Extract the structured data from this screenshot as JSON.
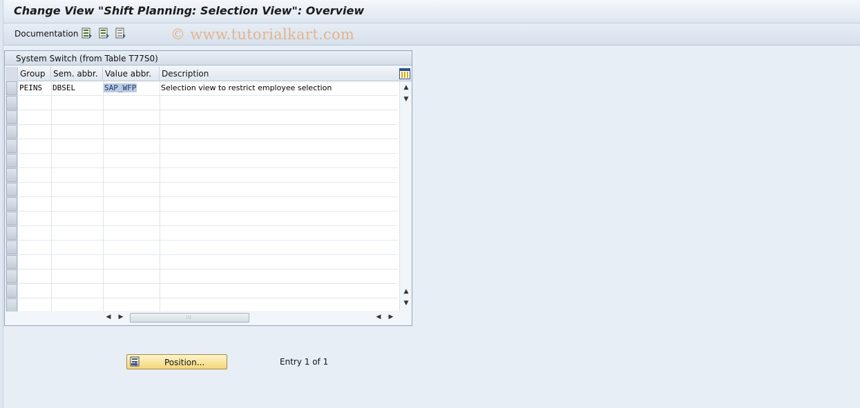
{
  "window": {
    "title": "Change View \"Shift Planning: Selection View\": Overview"
  },
  "toolbar": {
    "documentation_label": "Documentation",
    "icons": [
      "select-all-icon",
      "select-block-icon",
      "deselect-all-icon"
    ],
    "watermark": "© www.tutorialkart.com"
  },
  "panel": {
    "title": "System Switch (from Table T77S0)",
    "columns": [
      "Group",
      "Sem. abbr.",
      "Value abbr.",
      "Description"
    ],
    "rows": [
      {
        "group": "PEINS",
        "sem_abbr": "DBSEL",
        "value_abbr": "SAP_WFP",
        "description": "Selection view to restrict employee selection"
      }
    ],
    "visible_row_count": 16
  },
  "footer": {
    "position_label": "Position...",
    "entry_text": "Entry 1 of 1"
  },
  "colors": {
    "background": "#dfe8f1",
    "button_yellow": "#f4d679",
    "selected_value_bg": "#bccbe0"
  }
}
